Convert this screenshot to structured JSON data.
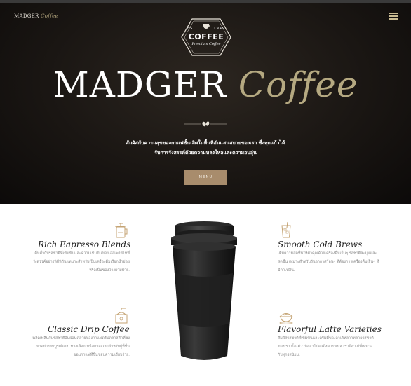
{
  "header": {
    "brand_main": "MADGER",
    "brand_accent": "Coffee",
    "menu_icon": "hamburger-icon"
  },
  "badge": {
    "est": "EST.",
    "year": "1949",
    "name": "COFFEE",
    "subtitle": "Premium Coffee"
  },
  "hero": {
    "title_main": "MADGER",
    "title_accent": "Coffee",
    "tagline_line1": "สัมผัสกับความสุขของกาแฟชั้นเลิศในพื้นที่อันแสนสบายของเรา ซึ่งทุกแก้วได้",
    "tagline_line2": "รับการรังสรรค์ด้วยความหลงใหลและความอบอุ่น",
    "button_label": "MENU"
  },
  "features": [
    {
      "icon": "french-press-icon",
      "title": "Rich Eapresso Blends",
      "line1": "ดื่มด่ำกับรสชาติที่เข้มข้นและความเข้มข้นของเอสเพรสโซที่",
      "line2": "รังสรรค์อย่างพิถีพิถัน เหมาะสำหรับเป็นเครื่องดื่มเรียกน้ำย่อย",
      "line3": "หรือเป็นของว่างยามบ่าย."
    },
    {
      "icon": "iced-coffee-icon",
      "title": "Smooth Cold Brews",
      "line1": "เติมความสดชื่นให้ตัวคุณด้วยเครื่องดื่มเย็นๆ รสชาติละมุนและ",
      "line2": "สดชื่น เหมาะสำหรับวันอากาศร้อนๆ ที่ต้องการเครื่องดื่มเย็นๆ ที่",
      "line3": "มีคาเฟอีน."
    },
    {
      "icon": "coffee-grinder-icon",
      "title": "Classic Drip Coffee",
      "line1": "เพลิดเพลินกับรสชาติอันผ่อนคลายของกาแฟดริปคลาสสิกที่ชง",
      "line2": "มาอย่างสมบูรณ์แบบ ทางเลือกเหนือกาลเวลาสำหรับผู้ที่ชื่น",
      "line3": "ชอบกาแฟที่ชื่นชอบความเรียบง่าย."
    },
    {
      "icon": "latte-cup-icon",
      "title": "Flavorful Latte Varieties",
      "line1": "สัมผัสรสชาติที่เข้มข้นและครีมมี่ของลาเต้หลากหลายรสชาติ",
      "line2": "ของเรา ตั้งแต่วานิลลาไปจนถึงคาราเมล เรามีลาเต้ที่เหมาะ",
      "line3": "กับทุกรสนิยม."
    }
  ],
  "colors": {
    "accent": "#b5a981",
    "button": "#a88c6c",
    "hero_bg": "#1a1613"
  }
}
